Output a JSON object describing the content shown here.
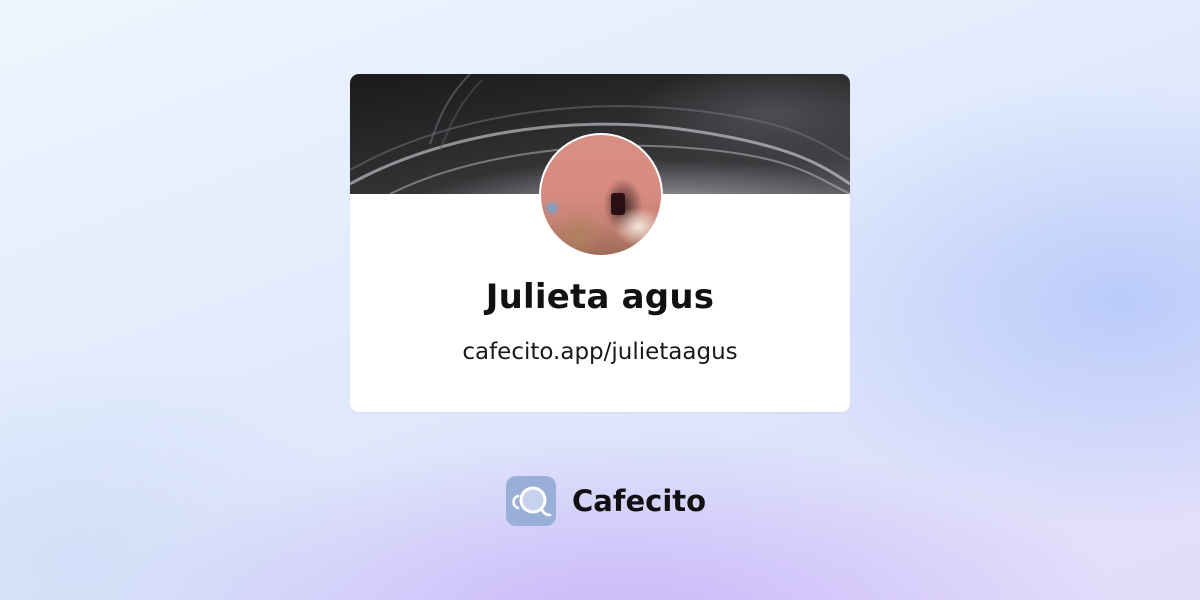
{
  "profile": {
    "name": "Julieta agus",
    "url": "cafecito.app/julietaagus"
  },
  "brand": {
    "name": "Cafecito",
    "logo_icon": "coffee-cup-icon",
    "logo_color": "#9aafd8"
  },
  "colors": {
    "card_background": "#ffffff",
    "text": "#111111"
  }
}
